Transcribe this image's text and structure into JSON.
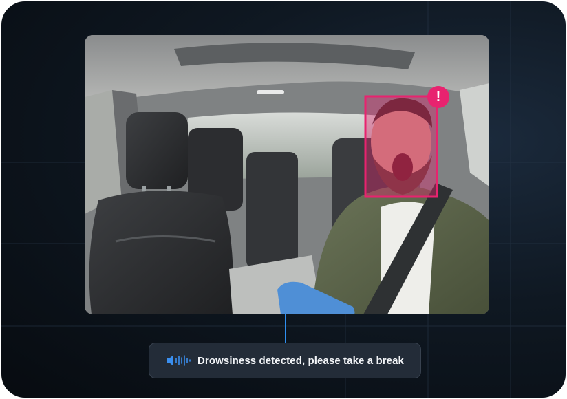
{
  "alert": {
    "message": "Drowsiness detected, please take a break",
    "badge_symbol": "!",
    "icon": "speaker-sound-wave-icon",
    "accent_color": "#e8236f",
    "connector_color": "#2f8ff0"
  },
  "camera_feed": {
    "icon": "face-detection-box-icon"
  }
}
